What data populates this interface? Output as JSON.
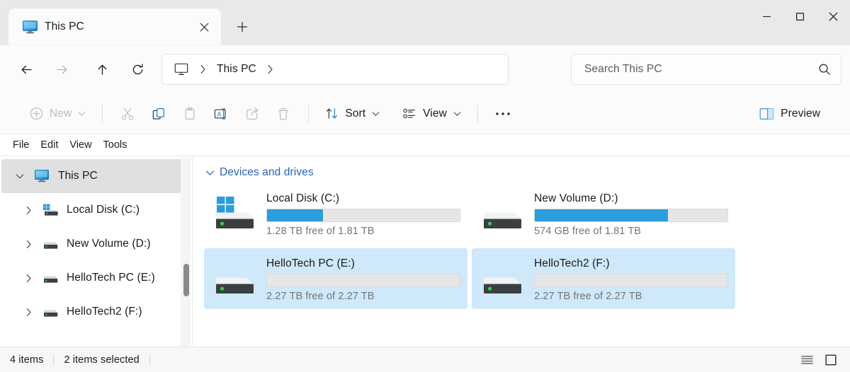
{
  "window": {
    "tab": {
      "title": "This PC",
      "icon": "this-pc-monitor-icon",
      "close_label": "×"
    },
    "new_tab_label": "+",
    "controls": {
      "minimize": "—",
      "maximize": "□",
      "close": "×"
    }
  },
  "addressbar": {
    "back": "back-arrow",
    "forward": "forward-arrow",
    "up": "up-arrow",
    "refresh": "refresh-arrow",
    "breadcrumb": {
      "root_icon": "this-pc-icon",
      "path": "This PC",
      "separator": "›"
    },
    "search": {
      "placeholder": "Search This PC",
      "value": "",
      "icon": "search-icon"
    }
  },
  "commandbar": {
    "items": [
      {
        "name": "new",
        "label": "New",
        "icon": "plus-circle-icon",
        "chevron": true,
        "dim": true
      },
      {
        "name": "cut",
        "label": "",
        "icon": "scissors-icon",
        "chevron": false,
        "dim": true
      },
      {
        "name": "copy",
        "label": "",
        "icon": "copy-icon",
        "chevron": false,
        "dim": false
      },
      {
        "name": "paste",
        "label": "",
        "icon": "clipboard-icon",
        "chevron": false,
        "dim": true
      },
      {
        "name": "rename",
        "label": "",
        "icon": "rename-icon",
        "chevron": false,
        "dim": false
      },
      {
        "name": "share",
        "label": "",
        "icon": "share-icon",
        "chevron": false,
        "dim": true
      },
      {
        "name": "delete",
        "label": "",
        "icon": "trash-icon",
        "chevron": false,
        "dim": true
      },
      {
        "name": "sort",
        "label": "Sort",
        "icon": "sort-icon",
        "chevron": true,
        "dim": false
      },
      {
        "name": "view",
        "label": "View",
        "icon": "view-icon",
        "chevron": true,
        "dim": false
      },
      {
        "name": "more",
        "label": "",
        "icon": "ellipsis-icon",
        "chevron": false,
        "dim": false
      },
      {
        "name": "preview",
        "label": "Preview",
        "icon": "preview-pane-icon",
        "chevron": false,
        "dim": false
      }
    ]
  },
  "menubar": {
    "items": [
      "File",
      "Edit",
      "View",
      "Tools"
    ]
  },
  "sidebar": {
    "items": [
      {
        "label": "This PC",
        "icon": "monitor-icon",
        "selected": true,
        "expanded": true,
        "child": false
      },
      {
        "label": "Local Disk (C:)",
        "icon": "windows-drive-icon",
        "selected": false,
        "expanded": false,
        "child": true
      },
      {
        "label": "New Volume (D:)",
        "icon": "drive-icon",
        "selected": false,
        "expanded": false,
        "child": true
      },
      {
        "label": "HelloTech PC (E:)",
        "icon": "drive-icon",
        "selected": false,
        "expanded": false,
        "child": true
      },
      {
        "label": "HelloTech2 (F:)",
        "icon": "drive-icon",
        "selected": false,
        "expanded": false,
        "child": true
      }
    ]
  },
  "content": {
    "group": {
      "label": "Devices and drives",
      "expanded": true,
      "color": "#2a62b8"
    },
    "drives": [
      {
        "name": "Local Disk (C:)",
        "free_text": "1.28 TB free of 1.81 TB",
        "used_percent": 29,
        "selected": false,
        "icon": "windows-drive-icon"
      },
      {
        "name": "New Volume (D:)",
        "free_text": "574 GB free of 1.81 TB",
        "used_percent": 69,
        "selected": false,
        "icon": "drive-icon"
      },
      {
        "name": "HelloTech PC (E:)",
        "free_text": "2.27 TB free of 2.27 TB",
        "used_percent": 0,
        "selected": true,
        "icon": "drive-icon"
      },
      {
        "name": "HelloTech2 (F:)",
        "free_text": "2.27 TB free of 2.27 TB",
        "used_percent": 0,
        "selected": true,
        "icon": "drive-icon"
      }
    ]
  },
  "statusbar": {
    "item_count": "4 items",
    "selection_count": "2 items selected",
    "views": [
      {
        "name": "details-view",
        "icon": "details-list-icon",
        "active": false
      },
      {
        "name": "large-icons-view",
        "icon": "large-icons-icon",
        "active": true
      }
    ]
  },
  "colors": {
    "accent_blue": "#2a9ddc",
    "selection_blue": "#cfe8fa",
    "link_blue": "#2a62b8",
    "sidebar_selected": "#e0e0e0"
  }
}
